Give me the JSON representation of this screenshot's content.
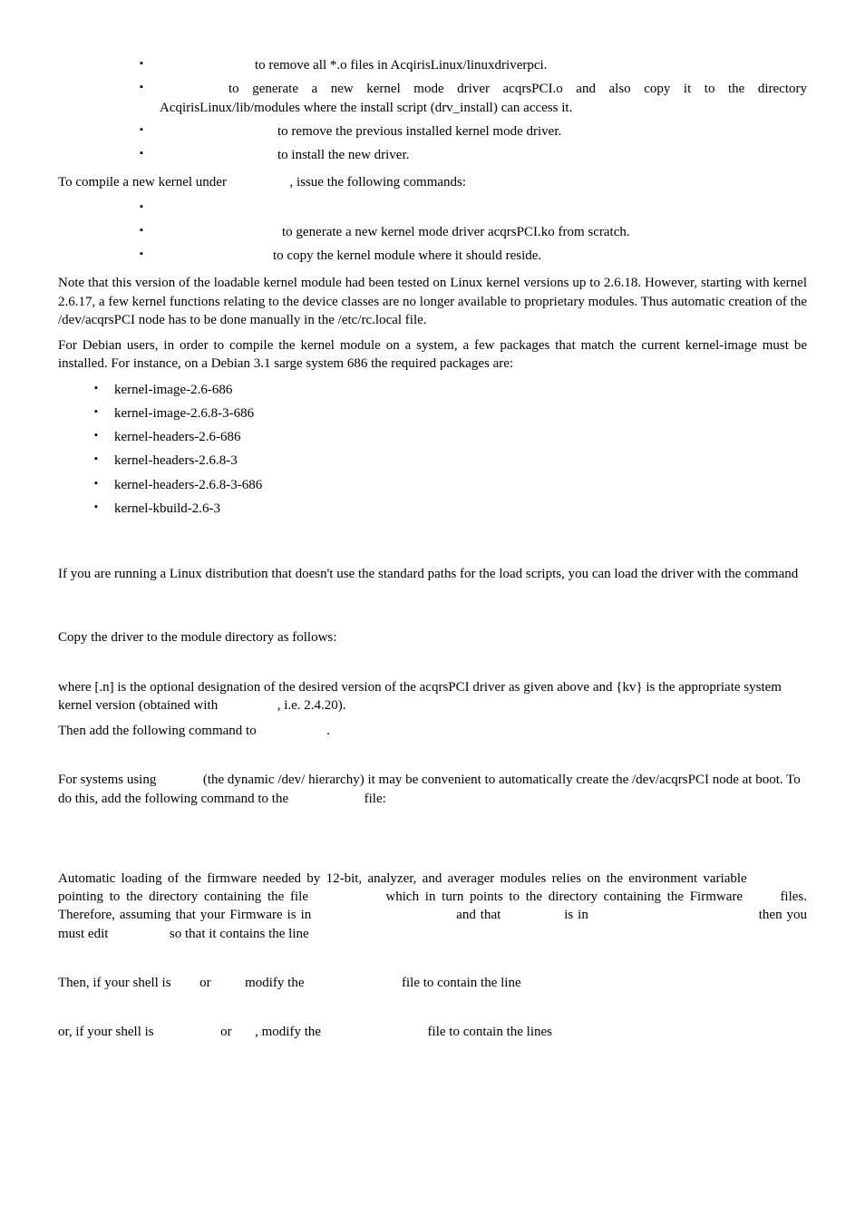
{
  "list1": {
    "i0": {
      "b": "to remove all *.o files in AcqirisLinux/linuxdriverpci."
    },
    "i1": {
      "b": "to generate a new kernel mode driver acqrsPCI.o and also copy it to the directory AcqirisLinux/lib/modules where the install script (drv_install) can access it."
    },
    "i2": {
      "b": "to remove the previous installed kernel mode driver."
    },
    "i3": {
      "b": "to install the new driver."
    }
  },
  "p_compile": {
    "a": "To compile a new kernel under ",
    "b": ", issue the following commands:"
  },
  "list2": {
    "i0": "",
    "i1": {
      "b": "to generate a new kernel mode driver acqrsPCI.ko from scratch."
    },
    "i2": {
      "b": "to copy the kernel module where it should reside."
    }
  },
  "p_note": "Note that this version of the loadable kernel module had been tested on Linux kernel versions up to 2.6.18. However, starting with kernel 2.6.17, a few kernel functions relating to the device classes are no longer available to proprietary modules. Thus automatic creation of the /dev/acqrsPCI node has to be done manually in the /etc/rc.local file.",
  "p_debian": "For Debian users, in order to compile the kernel module on a system, a few packages that match the current kernel-image must be installed. For instance, on a Debian 3.1 sarge system 686 the required packages are:",
  "pkg": {
    "i0": "kernel-image-2.6-686",
    "i1": "kernel-image-2.6.8-3-686",
    "i2": "kernel-headers-2.6-686",
    "i3": "kernel-headers-2.6.8-3",
    "i4": "kernel-headers-2.6.8-3-686",
    "i5": "kernel-kbuild-2.6-3"
  },
  "p_distro": "If you are running a Linux distribution that doesn't use the standard paths for the load scripts, you can load the driver with the command",
  "p_copy": "Copy the driver to the module directory as follows:",
  "p_where": {
    "a": "where [.n] is the optional designation of the desired version of the acqrsPCI driver as given above and {kv} is the appropriate system kernel version (obtained with ",
    "b": ", i.e. 2.4.20)."
  },
  "p_thenadd": {
    "a": "Then add the following command to ",
    "b": "."
  },
  "p_systems": {
    "a": "For systems using ",
    "b": " (the dynamic /dev/ hierarchy) it may be convenient to automatically create the /dev/acqrsPCI node at boot. To do this, add the following command to the ",
    "c": " file:"
  },
  "p_auto": {
    "a": "Automatic loading of the firmware needed by 12-bit, analyzer, and averager modules relies on the environment variable ",
    "b": " pointing to the directory containing the file ",
    "c": " which in turn points to the directory containing the Firmware ",
    "d": " files. Therefore, assuming that your Firmware is in ",
    "e": " and that ",
    "f": " is in ",
    "g": " then you must edit ",
    "h": " so that it contains the line"
  },
  "p_shell1": {
    "a": "Then, if your shell is ",
    "b": " or ",
    "c": " modify the ",
    "d": " file to contain the line"
  },
  "p_shell2": {
    "a": "or, if your shell is ",
    "b": " or ",
    "c": ", modify the ",
    "d": " file to contain the lines"
  }
}
